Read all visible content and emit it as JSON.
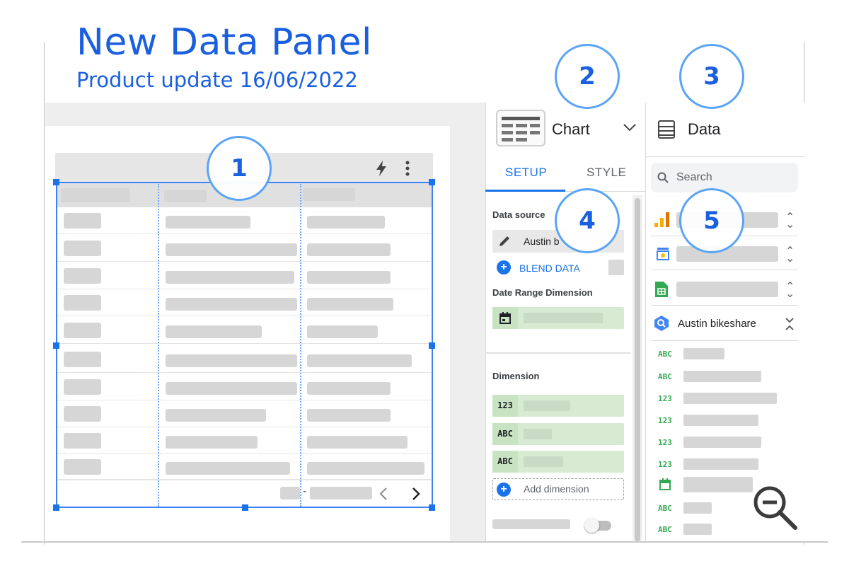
{
  "heading": {
    "title": "New Data Panel",
    "subtitle": "Product update 16/06/2022"
  },
  "callouts": [
    "1",
    "2",
    "3",
    "4",
    "5"
  ],
  "chart_table": {
    "toolbar_icons": [
      "lightning-icon",
      "more-vert-icon"
    ],
    "pagination_icons": [
      "chevron-left-icon",
      "chevron-right-icon"
    ],
    "pagination_dash": "-"
  },
  "properties_panel": {
    "chart_type_label": "Chart",
    "tabs": [
      "SETUP",
      "STYLE"
    ],
    "active_tab": "SETUP",
    "data_source_label": "Data source",
    "data_source_value": "Austin b",
    "blend_label": "BLEND DATA",
    "date_range_label": "Date Range Dimension",
    "dimension_label": "Dimension",
    "dimension_types": [
      "123",
      "ABC",
      "ABC"
    ],
    "add_dimension_label": "Add dimension"
  },
  "data_panel": {
    "title": "Data",
    "search_placeholder": "Search",
    "sources": [
      {
        "icon": "analytics-icon"
      },
      {
        "icon": "ads-icon"
      },
      {
        "icon": "sheets-icon"
      },
      {
        "icon": "bigquery-icon",
        "label": "Austin bikeshare",
        "expanded": true
      }
    ],
    "fields": [
      {
        "type": "ABC"
      },
      {
        "type": "ABC"
      },
      {
        "type": "123"
      },
      {
        "type": "123"
      },
      {
        "type": "123"
      },
      {
        "type": "123"
      },
      {
        "type": "calendar-icon"
      },
      {
        "type": "ABC"
      },
      {
        "type": "ABC"
      }
    ]
  },
  "colors": {
    "brand_blue": "#1a5fe0",
    "accent": "#1a73e8",
    "callout_ring": "#5aa4f5",
    "dimension_green": "#d6ebd2",
    "field_type_green": "#34a853"
  }
}
